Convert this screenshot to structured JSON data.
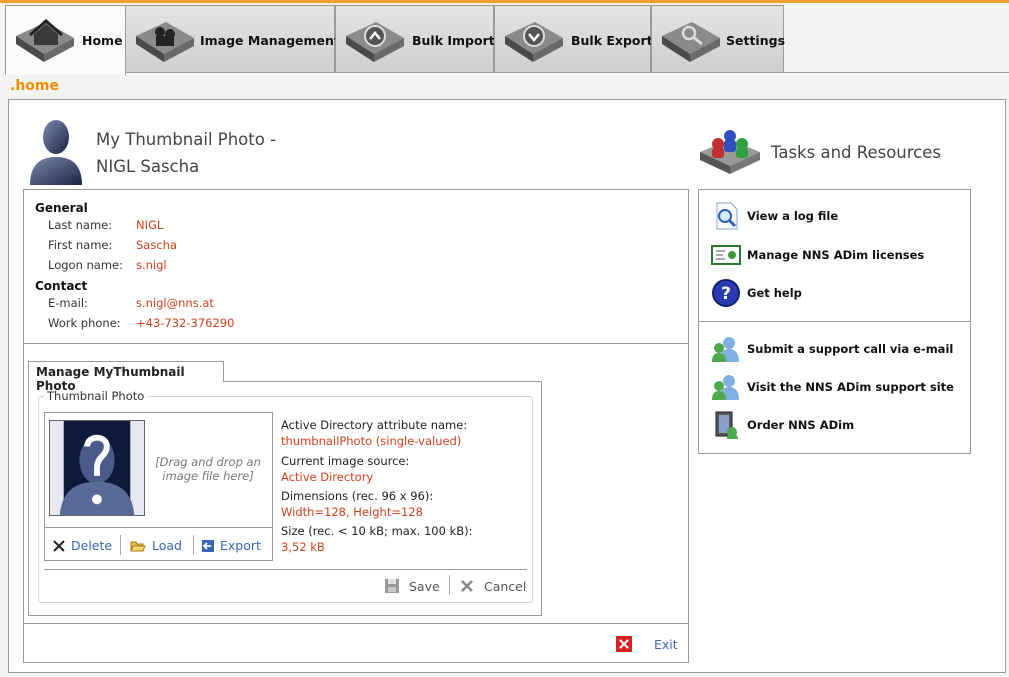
{
  "tabs": [
    {
      "label": "Home",
      "icon": "home-icon",
      "active": true
    },
    {
      "label": "Image Management",
      "icon": "image-management-icon",
      "active": false
    },
    {
      "label": "Bulk Import",
      "icon": "bulk-import-icon",
      "active": false
    },
    {
      "label": "Bulk Export",
      "icon": "bulk-export-icon",
      "active": false
    },
    {
      "label": "Settings",
      "icon": "settings-icon",
      "active": false
    }
  ],
  "breadcrumb": ".home",
  "header": {
    "title_line1": "My Thumbnail Photo -",
    "title_line2": "NIGL Sascha"
  },
  "tasks": {
    "title": "Tasks and Resources"
  },
  "general": {
    "heading": "General",
    "last_name_label": "Last name:",
    "last_name": "NIGL",
    "first_name_label": "First name:",
    "first_name": "Sascha",
    "logon_label": "Logon name:",
    "logon": "s.nigl"
  },
  "contact": {
    "heading": "Contact",
    "email_label": "E-mail:",
    "email": "s.nigl@nns.at",
    "phone_label": "Work phone:",
    "phone": "+43-732-376290"
  },
  "manage": {
    "tab_label": "Manage MyThumbnail Photo",
    "legend": "Thumbnail Photo",
    "dropzone": "[Drag and drop an image file here]",
    "delete_label": "Delete",
    "load_label": "Load",
    "export_label": "Export",
    "attr_name_label": "Active Directory attribute name:",
    "attr_name_value": "thumbnailPhoto (single-valued)",
    "source_label": "Current image source:",
    "source_value": "Active Directory",
    "dims_label": "Dimensions (rec. 96 x 96):",
    "dims_value": "Width=128, Height=128",
    "size_label": "Size (rec. < 10 kB; max. 100 kB):",
    "size_value": "3,52 kB",
    "save_label": "Save",
    "cancel_label": "Cancel"
  },
  "exit_label": "Exit",
  "resources": [
    {
      "label": "View a log file",
      "icon": "log-file-icon"
    },
    {
      "label": "Manage NNS ADim licenses",
      "icon": "license-icon"
    },
    {
      "label": "Get help",
      "icon": "help-icon"
    },
    {
      "label": "Submit a support call via e-mail",
      "icon": "support-mail-icon"
    },
    {
      "label": "Visit the NNS ADim support site",
      "icon": "support-site-icon"
    },
    {
      "label": "Order NNS ADim",
      "icon": "order-icon"
    }
  ],
  "colors": {
    "accent": "#f08c00",
    "value_text": "#d0401c",
    "link": "#3a66b8"
  }
}
